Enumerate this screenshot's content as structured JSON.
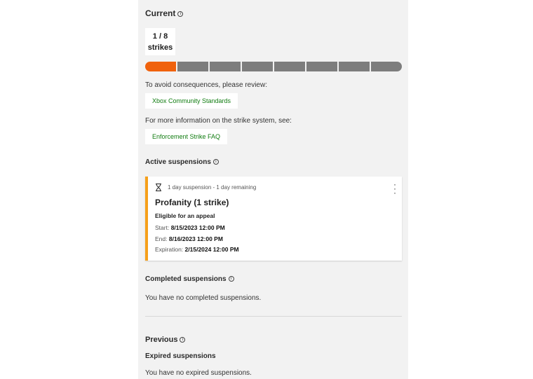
{
  "current": {
    "heading": "Current",
    "strike_count": "1 / 8",
    "strike_label": "strikes",
    "segments_total": 8,
    "segments_active": 1,
    "active_color": "#f0620d",
    "inactive_color": "#7d7d7d"
  },
  "review": {
    "prompt": "To avoid consequences, please review:",
    "link": "Xbox Community Standards"
  },
  "faq": {
    "prompt": "For more information on the strike system, see:",
    "link": "Enforcement Strike FAQ"
  },
  "active": {
    "heading": "Active suspensions",
    "card": {
      "duration": "1 day suspension - 1 day remaining",
      "title": "Profanity (1 strike)",
      "appeal": "Eligible for an appeal",
      "start_label": "Start:",
      "start": "8/15/2023 12:00 PM",
      "end_label": "End:",
      "end": "8/16/2023 12:00 PM",
      "expiration_label": "Expiration:",
      "expiration": "2/15/2024 12:00 PM",
      "accent_color": "#f6a01a"
    }
  },
  "completed": {
    "heading": "Completed suspensions",
    "empty": "You have no completed suspensions."
  },
  "previous": {
    "heading": "Previous",
    "expired_heading": "Expired suspensions",
    "empty": "You have no expired suspensions."
  }
}
